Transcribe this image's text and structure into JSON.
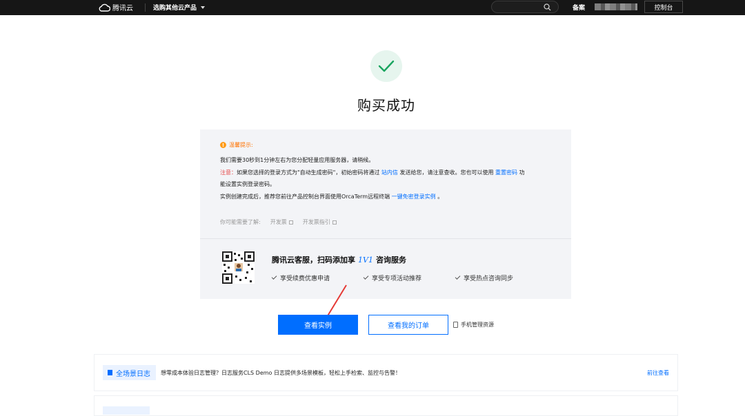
{
  "topbar": {
    "brand": "腾讯云",
    "products_menu": "选购其他云产品",
    "search_placeholder": "",
    "beian": "备案",
    "console": "控制台"
  },
  "success": {
    "title": "购买成功",
    "icon": "check-icon",
    "accent": "#1aa560"
  },
  "tips": {
    "heading": "温馨提示:",
    "line1": "我们需要30秒到1分钟左右为您分配轻量应用服务器，请稍候。",
    "note_label": "注意：",
    "note_text_a": "如果您选择的登录方式为\"自动生成密码\"，初始密码将通过",
    "note_link_inbox": "站内信",
    "note_text_b": "发送给您，请注意查收。您也可以使用",
    "note_link_reset": "重置密码",
    "note_text_c": "功",
    "line3": "能设置实例登录密码。",
    "line4_text": "实例创建完成后，推荐您前往产品控制台界面使用OrcaTerm远程终端",
    "line4_link": "一键免密登录实例",
    "line4_end": "。"
  },
  "learn_more": {
    "label": "你可能需要了解:",
    "links": [
      "开发票",
      "开发票指引"
    ]
  },
  "service": {
    "title_a": "腾讯云客服，扫码添加享",
    "title_badge": "1V1",
    "title_b": "咨询服务",
    "benefits": [
      "享受续费优惠申请",
      "享受专项活动推荐",
      "享受热点咨询同步"
    ]
  },
  "actions": {
    "view_instance": "查看实例",
    "view_orders": "查看我的订单",
    "mobile_manage": "手机管理资源"
  },
  "banner": {
    "tag": "全场景日志",
    "text": "想零成本体验日志管理？日志服务CLS Demo 日志提供多场景模板，轻松上手检索、监控与告警！",
    "link": "前往查看"
  },
  "colors": {
    "primary": "#006eff",
    "warning": "#ff7200",
    "danger": "#e54545",
    "topbar": "#161616"
  }
}
